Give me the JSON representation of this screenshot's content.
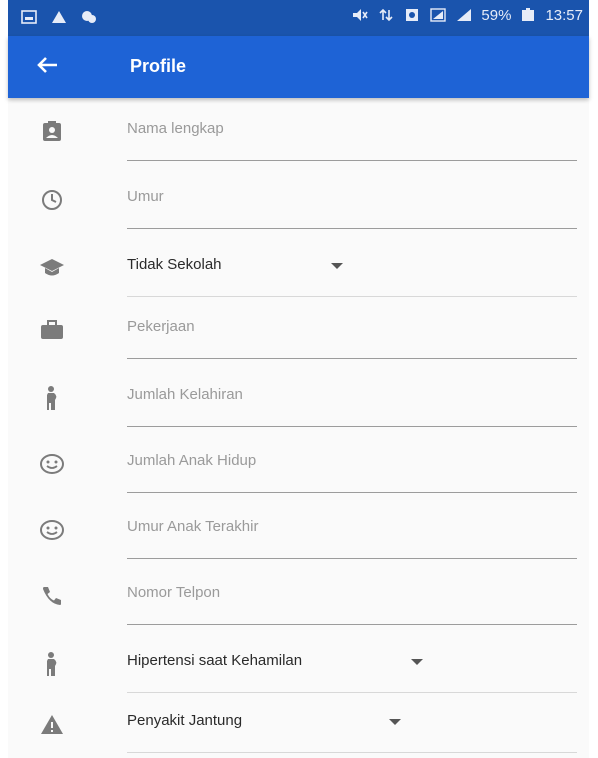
{
  "status_bar": {
    "battery_percent": "59%",
    "time": "13:57"
  },
  "app_bar": {
    "title": "Profile"
  },
  "form": {
    "nama_lengkap": {
      "placeholder": "Nama lengkap",
      "icon": "contact-card-icon"
    },
    "umur": {
      "placeholder": "Umur",
      "icon": "clock-icon"
    },
    "pendidikan": {
      "value": "Tidak Sekolah",
      "icon": "graduation-cap-icon"
    },
    "pekerjaan": {
      "placeholder": "Pekerjaan",
      "icon": "briefcase-icon"
    },
    "jumlah_kelahiran": {
      "placeholder": "Jumlah Kelahiran",
      "icon": "pregnant-woman-icon"
    },
    "jumlah_anak_hidup": {
      "placeholder": "Jumlah Anak Hidup",
      "icon": "smiley-face-icon"
    },
    "umur_anak_terakhir": {
      "placeholder": "Umur Anak Terakhir",
      "icon": "smiley-face-icon"
    },
    "nomor_telpon": {
      "placeholder": "Nomor Telpon",
      "icon": "phone-icon"
    },
    "hipertensi": {
      "value": "Hipertensi saat Kehamilan",
      "icon": "pregnant-woman-icon"
    },
    "penyakit_jantung": {
      "value": "Penyakit Jantung",
      "icon": "warning-icon"
    }
  },
  "colors": {
    "status_bar": "#1a54ad",
    "app_bar": "#1e63d6",
    "background": "#fafafa"
  }
}
